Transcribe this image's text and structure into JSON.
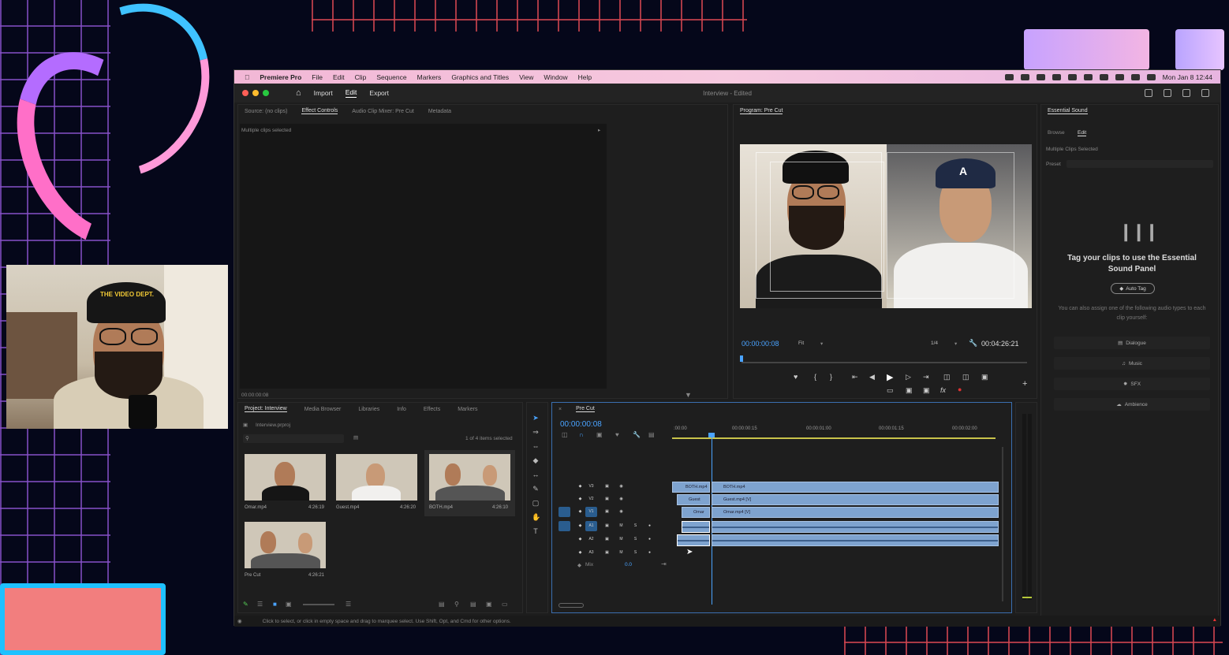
{
  "menubar": {
    "app_name": "Premiere Pro",
    "items": [
      "File",
      "Edit",
      "Clip",
      "Sequence",
      "Markers",
      "Graphics and Titles",
      "View",
      "Window",
      "Help"
    ],
    "clock": "Mon Jan 8  12:44"
  },
  "titlebar": {
    "tabs": [
      "Import",
      "Edit",
      "Export"
    ],
    "window_title": "Interview - Edited"
  },
  "source_panel": {
    "tabs": [
      "Source: (no clips)",
      "Effect Controls",
      "Audio Clip Mixer: Pre Cut",
      "Metadata"
    ],
    "message": "Multiple clips selected",
    "timecode": "00:00:00:08"
  },
  "program_monitor": {
    "title": "Program: Pre Cut",
    "current_time": "00:00:00:08",
    "fit": "Fit",
    "resolution": "1/4",
    "duration": "00:04:26:21"
  },
  "essential_sound": {
    "title": "Essential Sound",
    "tabs": [
      "Browse",
      "Edit"
    ],
    "status": "Multiple Clips Selected",
    "preset_label": "Preset",
    "heading": "Tag your clips to use the Essential Sound Panel",
    "auto_tag": "Auto Tag",
    "note": "You can also assign one of the following audio types to each clip yourself:",
    "types": [
      "Dialogue",
      "Music",
      "SFX",
      "Ambience"
    ]
  },
  "project_panel": {
    "tabs": [
      "Project: Interview",
      "Media Browser",
      "Libraries",
      "Info",
      "Effects",
      "Markers"
    ],
    "file": "Interview.prproj",
    "selection": "1 of 4 items selected",
    "items": [
      {
        "name": "Omar.mp4",
        "duration": "4:26:19"
      },
      {
        "name": "Guest.mp4",
        "duration": "4:26:20"
      },
      {
        "name": "BOTH.mp4",
        "duration": "4:26:10"
      },
      {
        "name": "Pre Cut",
        "duration": "4:26:21"
      }
    ]
  },
  "timeline": {
    "sequence": "Pre Cut",
    "timecode": "00:00:00:08",
    "ruler": [
      ":00:00",
      "00:00:00:15",
      "00:00:01:00",
      "00:00:01:15",
      "00:00:02:00"
    ],
    "video_tracks": [
      "V3",
      "V2",
      "V1"
    ],
    "audio_tracks": [
      "A1",
      "A2",
      "A3"
    ],
    "mix_label": "Mix",
    "mix_value": "0.0",
    "clips": {
      "v3_short": "BOTH.mp4",
      "v3": "BOTH.mp4",
      "v2_short": "Guest",
      "v2": "Guest.mp4 [V]",
      "v1_short": "Omar",
      "v1": "Omar.mp4 [V]"
    }
  },
  "status_bar": "Click to select, or click in empty space and drag to marquee select. Use Shift, Opt, and Cmd for other options.",
  "webcam_overlay": {
    "cap_text": "THE VIDEO DEPT."
  },
  "colors": {
    "accent_blue": "#4aa3ff",
    "clip_blue": "#7ea3cf",
    "menubar_pink": "#f4c1dc",
    "panel_bg": "#1e1e1e"
  }
}
